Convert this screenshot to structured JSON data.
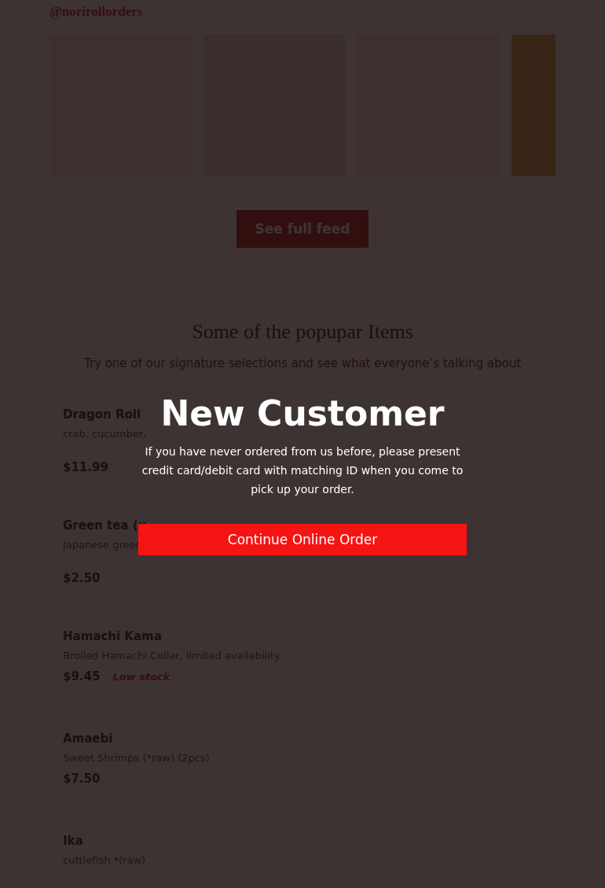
{
  "page": {
    "handle": "@norirollorders",
    "feed": [
      {
        "label": "christmas-card"
      },
      {
        "label": "sushi-photo"
      },
      {
        "label": "thanksgiving-card"
      },
      {
        "label": "sushi-photo-2"
      }
    ],
    "feed_button": "See full feed",
    "section_title": "Some of the popupar Items",
    "section_subtitle": "Try one of our signature selections and see what everyone’s talking about",
    "items": [
      {
        "name": "Dragon Roll",
        "description": "crab, cucumber,",
        "price": "$11.99",
        "badge": ""
      },
      {
        "name": "Green tea (u",
        "description": "Japanese green tea",
        "price": "$2.50",
        "badge": ""
      },
      {
        "name": "Hamachi Kama",
        "description": "Broiled Hamachi Collar, limited availability.",
        "price": "$9.45",
        "badge": "Low stock"
      },
      {
        "name": "Amaebi",
        "description": "Sweet Shrimps (*raw) (2pcs)",
        "price": "$7.50",
        "badge": ""
      },
      {
        "name": "Ika",
        "description": "cuttlefish *(raw)",
        "price": "",
        "badge": ""
      }
    ]
  },
  "modal": {
    "title": "New Customer",
    "message": "If you have never ordered from us before, please present credit card/debit card with matching ID when you come to pick up your order.",
    "button": "Continue Online Order"
  }
}
